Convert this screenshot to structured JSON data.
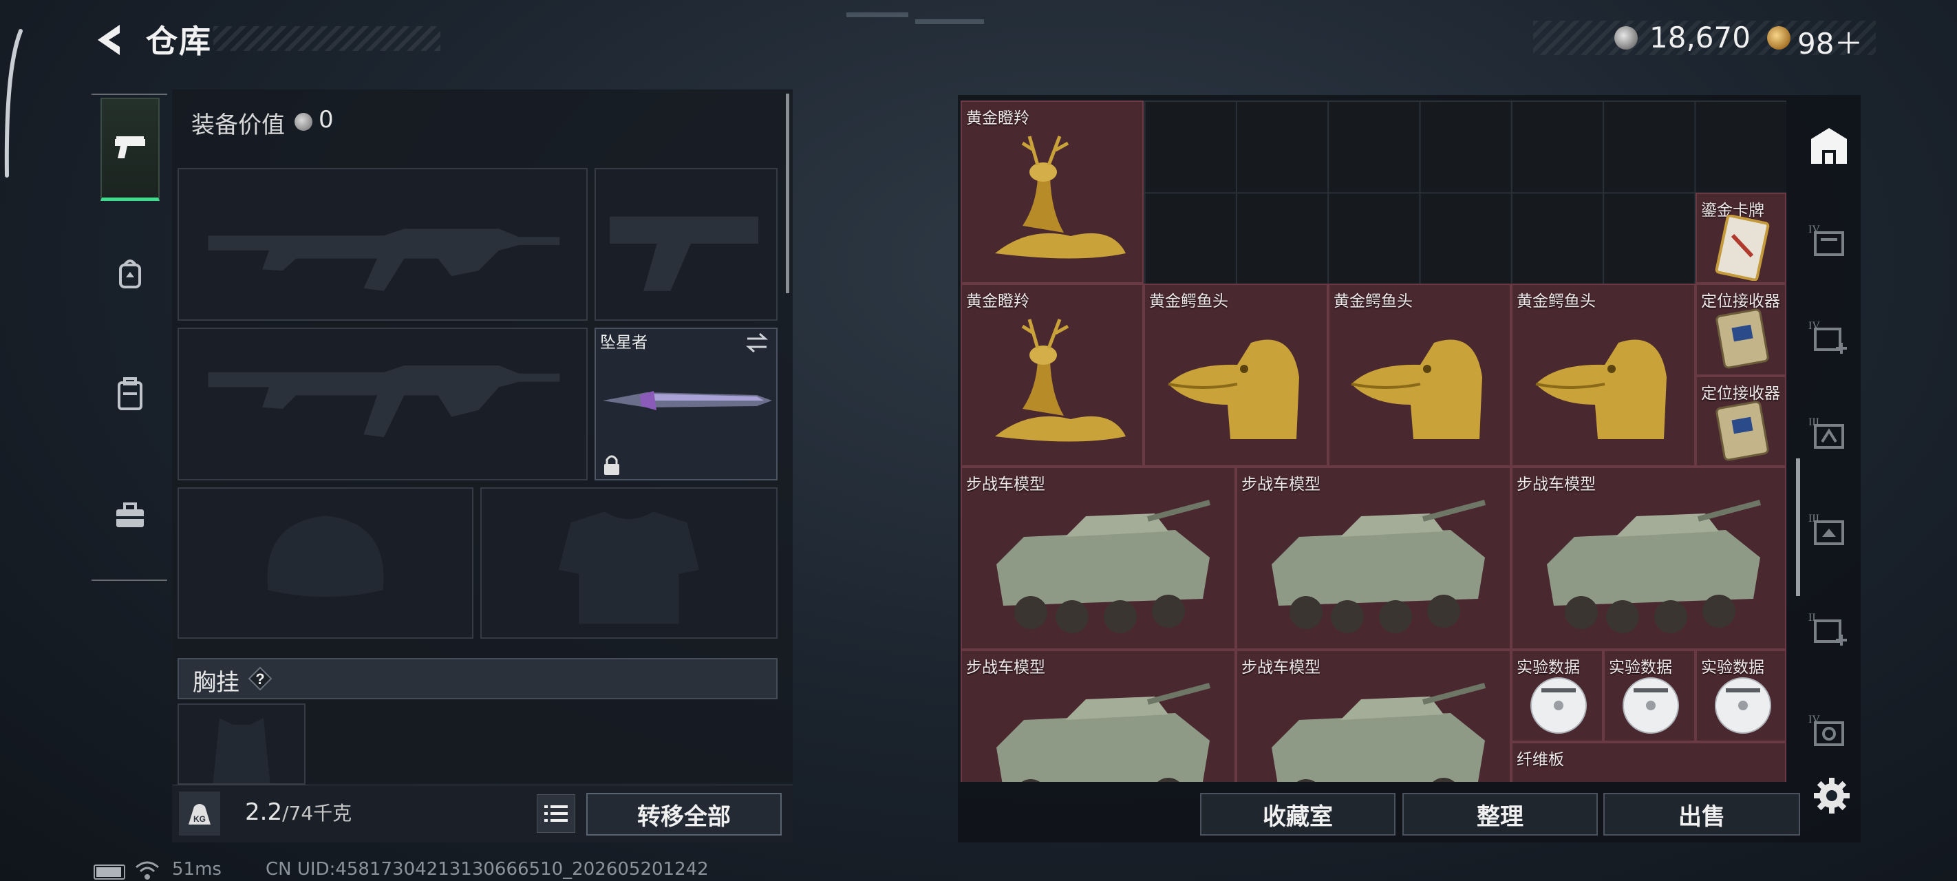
{
  "header": {
    "title": "仓库",
    "silver_amount": "18,670",
    "gold_amount": "98＋"
  },
  "loadout": {
    "gear_value_label": "装备价值",
    "gear_value": "0",
    "melee_name": "坠星者",
    "chest_label": "胸挂",
    "weight_value": "2.2",
    "weight_capacity": "/74千克",
    "transfer_all_label": "转移全部"
  },
  "stash": {
    "items": [
      {
        "name": "黄金瞪羚",
        "icon": "gold-gazelle-statue"
      },
      {
        "name": "鎏金卡牌",
        "icon": "gilded-card"
      },
      {
        "name": "黄金瞪羚",
        "icon": "gold-gazelle-statue"
      },
      {
        "name": "黄金鳄鱼头",
        "icon": "gold-crocodile-head"
      },
      {
        "name": "黄金鳄鱼头",
        "icon": "gold-crocodile-head"
      },
      {
        "name": "黄金鳄鱼头",
        "icon": "gold-crocodile-head"
      },
      {
        "name": "定位接收器",
        "icon": "locator-receiver"
      },
      {
        "name": "定位接收器",
        "icon": "locator-receiver"
      },
      {
        "name": "步战车模型",
        "icon": "ifv-model"
      },
      {
        "name": "步战车模型",
        "icon": "ifv-model"
      },
      {
        "name": "步战车模型",
        "icon": "ifv-model"
      },
      {
        "name": "步战车模型",
        "icon": "ifv-model"
      },
      {
        "name": "步战车模型",
        "icon": "ifv-model"
      },
      {
        "name": "实验数据",
        "icon": "data-disc"
      },
      {
        "name": "实验数据",
        "icon": "data-disc"
      },
      {
        "name": "实验数据",
        "icon": "data-disc"
      },
      {
        "name": "纤维板",
        "icon": "fiberboard"
      }
    ],
    "tabs": [
      {
        "roman": "",
        "icon": "stash-home-icon"
      },
      {
        "roman": "IV",
        "icon": "stash-tab-icon"
      },
      {
        "roman": "IV",
        "icon": "stash-tab-add-icon"
      },
      {
        "roman": "III",
        "icon": "stash-tab-icon"
      },
      {
        "roman": "III",
        "icon": "stash-tab-icon"
      },
      {
        "roman": "II",
        "icon": "stash-tab-add-icon"
      },
      {
        "roman": "IV",
        "icon": "stash-tab-icon"
      }
    ],
    "collection_label": "收藏室",
    "organize_label": "整理",
    "sell_label": "出售"
  },
  "status_bar": {
    "ping": "51ms",
    "uid": "CN UID:45817304213130666510_202605201242"
  },
  "colors": {
    "accent_green": "#3fdc8e",
    "item_bg": "#4a2830",
    "panel_bg": "#161b22"
  }
}
